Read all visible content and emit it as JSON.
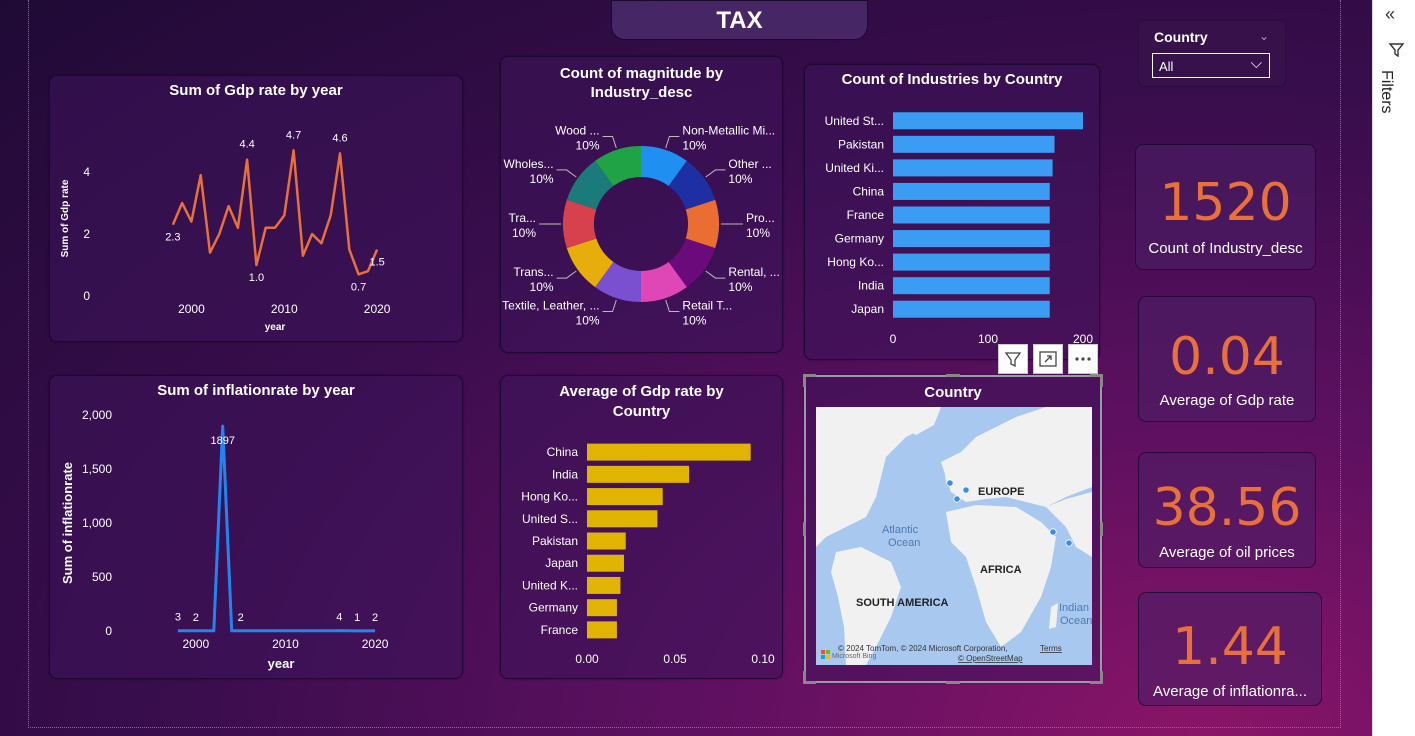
{
  "report": {
    "title": "TAX"
  },
  "filters_pane": {
    "label": "Filters",
    "collapse_icon": "double-chevron-left-icon",
    "filter_icon": "funnel-icon"
  },
  "slicer": {
    "label": "Country",
    "value": "All"
  },
  "kpis": [
    {
      "value": "1520",
      "label": "Count of Industry_desc"
    },
    {
      "value": "0.04",
      "label": "Average of Gdp rate"
    },
    {
      "value": "38.56",
      "label": "Average of oil prices"
    },
    {
      "value": "1.44",
      "label": "Average of inflationra..."
    }
  ],
  "visual_toolbar": {
    "icons": [
      "filter-icon",
      "focus-mode-icon",
      "more-options-icon"
    ]
  },
  "map": {
    "title": "Country",
    "labels": [
      "EUROPE",
      "Atlantic",
      "Ocean",
      "AFRICA",
      "SOUTH AMERICA",
      "Indian",
      "Ocean"
    ],
    "attribution": "© 2024 TomTom, © 2024 Microsoft Corporation,",
    "terms": "Terms",
    "osm": "© OpenStreetMap",
    "bing": "Microsoft Bing",
    "colors": {
      "water": "#a9c8f0",
      "land": "#f1f1f1",
      "point": "#3a8ee6"
    }
  },
  "chart_data": [
    {
      "id": "gdp_by_year",
      "type": "line",
      "title": "Sum of Gdp rate by year",
      "xlabel": "year",
      "ylabel": "Sum of Gdp rate",
      "color": "#e8703a",
      "xlim": [
        1995,
        2023
      ],
      "ylim": [
        0,
        5
      ],
      "xticks": [
        2000,
        2010,
        2020
      ],
      "yticks": [
        0,
        2,
        4
      ],
      "x": [
        1998,
        1999,
        2000,
        2001,
        2002,
        2003,
        2004,
        2005,
        2006,
        2007,
        2008,
        2009,
        2010,
        2011,
        2012,
        2013,
        2014,
        2015,
        2016,
        2017,
        2018,
        2019,
        2020
      ],
      "y": [
        2.3,
        3.0,
        2.4,
        3.9,
        1.4,
        2.0,
        2.9,
        2.2,
        4.4,
        1.0,
        2.2,
        2.2,
        2.6,
        4.7,
        1.3,
        2.0,
        1.7,
        2.6,
        4.6,
        1.5,
        0.7,
        0.8,
        1.5
      ],
      "data_labels": [
        {
          "x": 1998,
          "y": 2.3,
          "text": "2.3"
        },
        {
          "x": 2006,
          "y": 4.4,
          "text": "4.4"
        },
        {
          "x": 2007,
          "y": 1.0,
          "text": "1.0"
        },
        {
          "x": 2011,
          "y": 4.7,
          "text": "4.7"
        },
        {
          "x": 2016,
          "y": 4.6,
          "text": "4.6"
        },
        {
          "x": 2018,
          "y": 0.7,
          "text": "0.7"
        },
        {
          "x": 2020,
          "y": 1.5,
          "text": "1.5"
        }
      ]
    },
    {
      "id": "magnitude_by_industry",
      "type": "pie",
      "title": "Count of magnitude by Industry_desc",
      "slices": [
        {
          "label": "Non-Metallic Mi...",
          "value": 10,
          "text": "10%",
          "color": "#1f8ff2"
        },
        {
          "label": "Other ...",
          "value": 10,
          "text": "10%",
          "color": "#1e2fa3"
        },
        {
          "label": "Pro...",
          "value": 10,
          "text": "10%",
          "color": "#ea6d31"
        },
        {
          "label": "Rental, ...",
          "value": 10,
          "text": "10%",
          "color": "#6b0a7a"
        },
        {
          "label": "Retail T...",
          "value": 10,
          "text": "10%",
          "color": "#e047b6"
        },
        {
          "label": "Textile, Leather, ...",
          "value": 10,
          "text": "10%",
          "color": "#7b50d0"
        },
        {
          "label": "Trans...",
          "value": 10,
          "text": "10%",
          "color": "#e7ad0b"
        },
        {
          "label": "Tra...",
          "value": 10,
          "text": "10%",
          "color": "#d6414d"
        },
        {
          "label": "Wholes...",
          "value": 10,
          "text": "10%",
          "color": "#1b7a7a"
        },
        {
          "label": "Wood ...",
          "value": 10,
          "text": "10%",
          "color": "#1fa345"
        }
      ]
    },
    {
      "id": "industries_by_country",
      "type": "bar",
      "orientation": "horizontal",
      "title": "Count of Industries by Country",
      "color": "#3a9cf2",
      "categories": [
        "United St...",
        "Pakistan",
        "United Ki...",
        "China",
        "France",
        "Germany",
        "Hong Ko...",
        "India",
        "Japan"
      ],
      "values": [
        200,
        170,
        168,
        165,
        165,
        165,
        165,
        165,
        165
      ],
      "xlim": [
        0,
        200
      ],
      "xticks": [
        0,
        100,
        200
      ]
    },
    {
      "id": "inflation_by_year",
      "type": "line",
      "title": "Sum of inflationrate by year",
      "xlabel": "year",
      "ylabel": "Sum of inflationrate",
      "color": "#1f86f0",
      "xlim": [
        1996,
        2023
      ],
      "ylim": [
        0,
        2000
      ],
      "xticks": [
        2000,
        2010,
        2020
      ],
      "ytick_labels": [
        "0",
        "500",
        "1,000",
        "1,500",
        "2,000"
      ],
      "yticks": [
        0,
        500,
        1000,
        1500,
        2000
      ],
      "x": [
        1998,
        1999,
        2000,
        2001,
        2002,
        2003,
        2004,
        2005,
        2006,
        2007,
        2008,
        2009,
        2010,
        2011,
        2012,
        2013,
        2014,
        2015,
        2016,
        2017,
        2018,
        2019,
        2020
      ],
      "y": [
        3,
        3,
        2,
        2,
        2,
        1897,
        2,
        2,
        2,
        2,
        2,
        2,
        2,
        2,
        2,
        2,
        2,
        2,
        4,
        2,
        1,
        1,
        2
      ],
      "data_labels": [
        {
          "x": 1998,
          "y": 3,
          "text": "3"
        },
        {
          "x": 2000,
          "y": 2,
          "text": "2"
        },
        {
          "x": 2003,
          "y": 1897,
          "text": "1897"
        },
        {
          "x": 2005,
          "y": 2,
          "text": "2"
        },
        {
          "x": 2016,
          "y": 4,
          "text": "4"
        },
        {
          "x": 2018,
          "y": 1,
          "text": "1"
        },
        {
          "x": 2020,
          "y": 2,
          "text": "2"
        }
      ]
    },
    {
      "id": "gdp_by_country",
      "type": "bar",
      "orientation": "horizontal",
      "title": "Average of Gdp rate by Country",
      "color": "#e0b400",
      "categories": [
        "China",
        "India",
        "Hong Ko...",
        "United S...",
        "Pakistan",
        "Japan",
        "United K...",
        "Germany",
        "France"
      ],
      "values": [
        0.093,
        0.058,
        0.043,
        0.04,
        0.022,
        0.021,
        0.019,
        0.017,
        0.017
      ],
      "xlim": [
        0,
        0.1
      ],
      "xticks": [
        0,
        0.05,
        0.1
      ],
      "xtick_labels": [
        "0.00",
        "0.05",
        "0.10"
      ]
    }
  ]
}
